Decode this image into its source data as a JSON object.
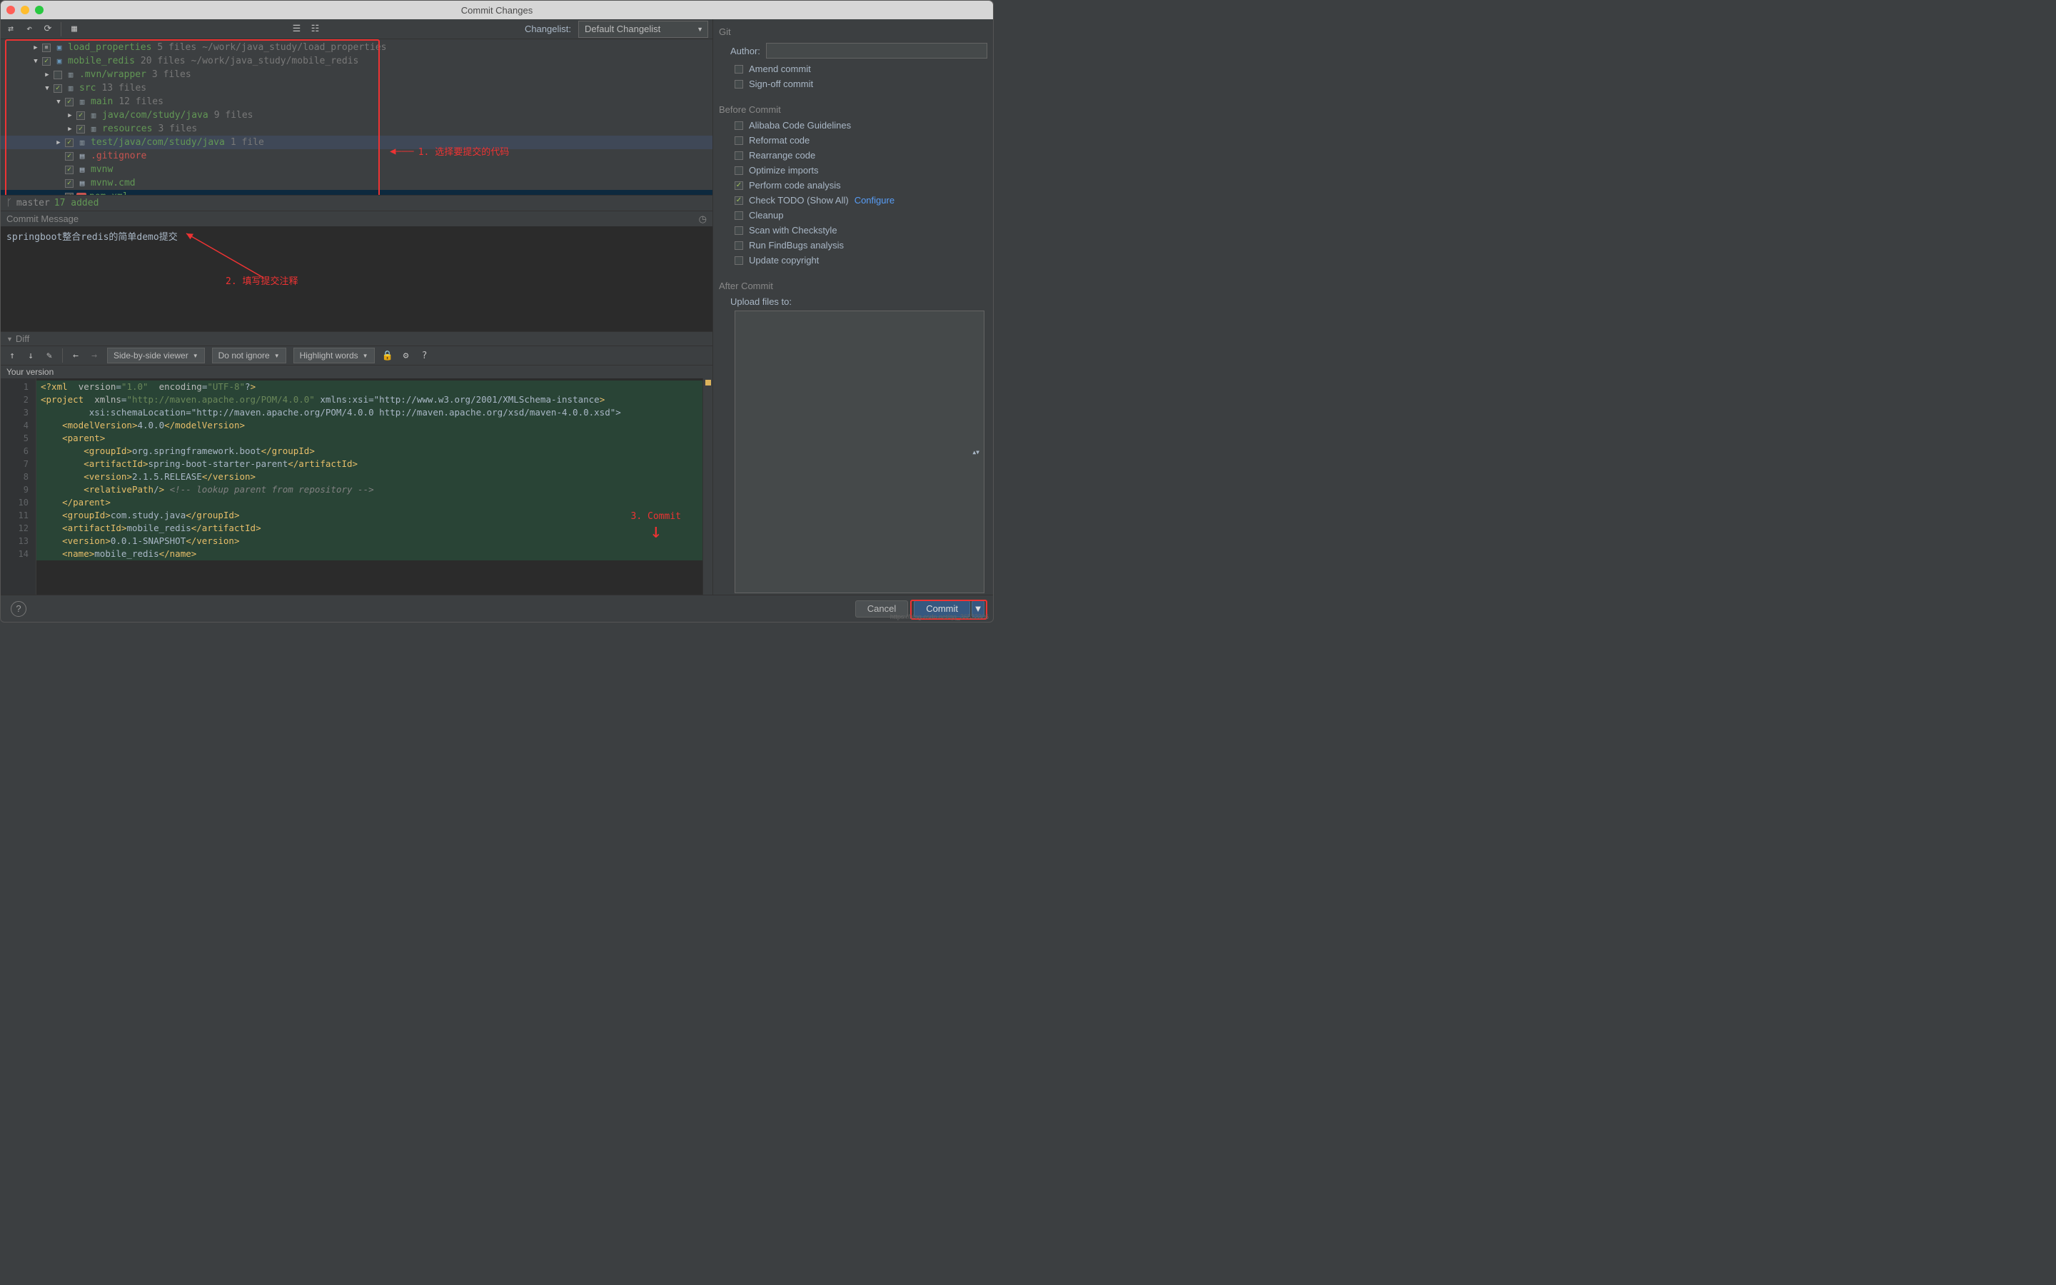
{
  "window": {
    "title": "Commit Changes"
  },
  "toolbar": {
    "changelist_label": "Changelist:",
    "changelist_value": "Default Changelist"
  },
  "tree": {
    "rows": [
      {
        "indent": 44,
        "chev": "▶",
        "cbx": "tri",
        "icon": "mod",
        "name": "load_properties",
        "meta1": "5 files",
        "meta2": "~/work/java_study/load_properties"
      },
      {
        "indent": 44,
        "chev": "▼",
        "cbx": "chk",
        "icon": "mod",
        "name": "mobile_redis",
        "meta1": "20 files",
        "meta2": "~/work/java_study/mobile_redis"
      },
      {
        "indent": 60,
        "chev": "▶",
        "cbx": "",
        "icon": "dir",
        "name": ".mvn/wrapper",
        "meta1": "3 files"
      },
      {
        "indent": 60,
        "chev": "▼",
        "cbx": "chk",
        "icon": "dir",
        "name": "src",
        "meta1": "13 files"
      },
      {
        "indent": 76,
        "chev": "▼",
        "cbx": "chk",
        "icon": "dir",
        "name": "main",
        "meta1": "12 files"
      },
      {
        "indent": 92,
        "chev": "▶",
        "cbx": "chk",
        "icon": "dir",
        "name": "java/com/study/java",
        "meta1": "9 files"
      },
      {
        "indent": 92,
        "chev": "▶",
        "cbx": "chk",
        "icon": "dir",
        "name": "resources",
        "meta1": "3 files"
      },
      {
        "indent": 76,
        "chev": "▶",
        "cbx": "chk",
        "icon": "dir",
        "name": "test/java/com/study/java",
        "meta1": "1 file",
        "hl": true
      },
      {
        "indent": 76,
        "chev": "",
        "cbx": "chk",
        "icon": "file",
        "name": ".gitignore",
        "color": "#c75450"
      },
      {
        "indent": 76,
        "chev": "",
        "cbx": "chk",
        "icon": "file",
        "name": "mvnw"
      },
      {
        "indent": 76,
        "chev": "",
        "cbx": "chk",
        "icon": "file",
        "name": "mvnw.cmd"
      },
      {
        "indent": 76,
        "chev": "",
        "cbx": "chk",
        "icon": "xml",
        "name": "pom.xml",
        "sel": true
      }
    ],
    "branch_icon": "ᚴ",
    "branch": "master",
    "added": "17 added"
  },
  "annotations": {
    "a1": "1. 选择要提交的代码",
    "a2": "2. 填写提交注释",
    "a3": "3. Commit"
  },
  "commit_message": {
    "header": "Commit Message",
    "text": "springboot整合redis的简单demo提交"
  },
  "diff": {
    "header": "Diff",
    "viewer": "Side-by-side viewer",
    "ignore": "Do not ignore",
    "highlight": "Highlight words",
    "your_version": "Your version",
    "lines": [
      "<?xml version=\"1.0\" encoding=\"UTF-8\"?>",
      "<project xmlns=\"http://maven.apache.org/POM/4.0.0\" xmlns:xsi=\"http://www.w3.org/2001/XMLSchema-instance\"",
      "         xsi:schemaLocation=\"http://maven.apache.org/POM/4.0.0 http://maven.apache.org/xsd/maven-4.0.0.xsd\">",
      "    <modelVersion>4.0.0</modelVersion>",
      "    <parent>",
      "        <groupId>org.springframework.boot</groupId>",
      "        <artifactId>spring-boot-starter-parent</artifactId>",
      "        <version>2.1.5.RELEASE</version>",
      "        <relativePath/> <!-- lookup parent from repository -->",
      "    </parent>",
      "    <groupId>com.study.java</groupId>",
      "    <artifactId>mobile_redis</artifactId>",
      "    <version>0.0.1-SNAPSHOT</version>",
      "    <name>mobile_redis</name>"
    ]
  },
  "right": {
    "git": "Git",
    "author": "Author:",
    "amend": "Amend commit",
    "signoff": "Sign-off commit",
    "before": "Before Commit",
    "checks": [
      {
        "label": "Alibaba Code Guidelines",
        "on": false
      },
      {
        "label": "Reformat code",
        "on": false
      },
      {
        "label": "Rearrange code",
        "on": false
      },
      {
        "label": "Optimize imports",
        "on": false
      },
      {
        "label": "Perform code analysis",
        "on": true
      },
      {
        "label": "Check TODO (Show All)",
        "on": true,
        "link": "Configure"
      },
      {
        "label": "Cleanup",
        "on": false
      },
      {
        "label": "Scan with Checkstyle",
        "on": false
      },
      {
        "label": "Run FindBugs analysis",
        "on": false
      },
      {
        "label": "Update copyright",
        "on": false
      }
    ],
    "after": "After Commit",
    "upload": "Upload files to:"
  },
  "footer": {
    "cancel": "Cancel",
    "commit": "Commit",
    "help": "?"
  },
  "watermark": "https://blog.csdn.net/qq_36522306"
}
